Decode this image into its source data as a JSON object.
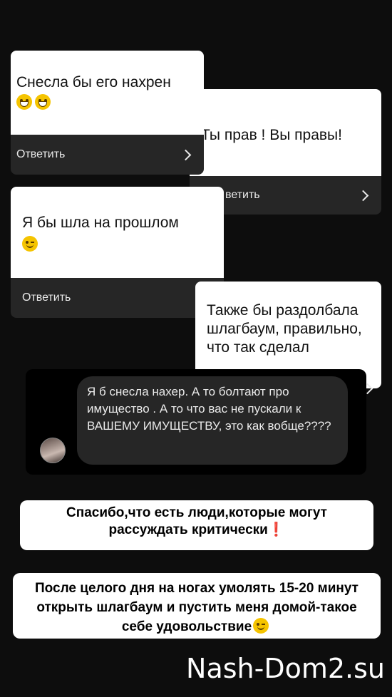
{
  "cards": [
    {
      "question": "Снесла бы его нахрен",
      "emoji": [
        "grin-emoji",
        "grin-emoji"
      ],
      "reply_label": "Ответить"
    },
    {
      "question": "Ты прав ! Вы правы!",
      "reply_label": "ветить"
    },
    {
      "question": "Я бы шла на прошлом",
      "emoji": [
        "wink-emoji"
      ],
      "reply_label": "Ответить"
    },
    {
      "question": "Также бы раздолбала шлагбаум, правильно, что так сделал"
    }
  ],
  "dm": {
    "message": "Я б снесла нахер. А то болтают про имущество . А то что вас не пускали к ВАШЕМУ ИМУЩЕСТВУ, это как вобще????"
  },
  "stickers": {
    "thanks": {
      "text": "Спасибо,что есть люди,которые могут рассуждать критически",
      "emoji": "❗"
    },
    "after_day": {
      "text": "После целого дня на ногах умолять 15-20 минут открыть шлагбаум и пустить меня домой-такое себе удовольствие",
      "emoji": "wink-emoji"
    }
  },
  "watermark": "Nash-Dom2.su",
  "colors": {
    "background": "#0d0d0d",
    "card": "#ffffff",
    "reply_bar": "#262626",
    "accent_red": "#e00000"
  }
}
